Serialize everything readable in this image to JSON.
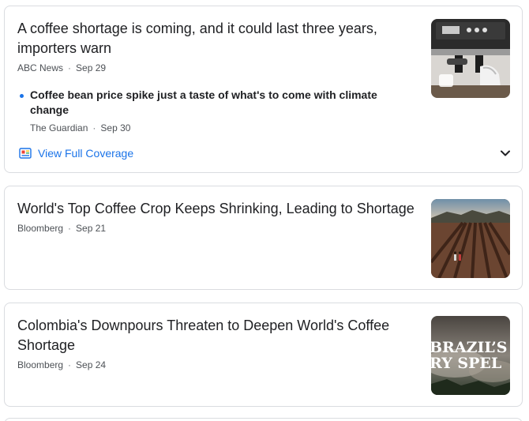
{
  "articles": [
    {
      "title": "A coffee shortage is coming, and it could last three years, importers warn",
      "source": "ABC News",
      "date": "Sep 29",
      "related": {
        "title": "Coffee bean price spike just a taste of what's to come with climate change",
        "source": "The Guardian",
        "date": "Sep 30"
      },
      "coverage_label": "View Full Coverage",
      "thumb_icon": "espresso-machine-photo"
    },
    {
      "title": "World's Top Coffee Crop Keeps Shrinking, Leading to Shortage",
      "source": "Bloomberg",
      "date": "Sep 21",
      "thumb_icon": "coffee-field-photo"
    },
    {
      "title": "Colombia's Downpours Threaten to Deepen World's Coffee Shortage",
      "source": "Bloomberg",
      "date": "Sep 24",
      "thumb_icon": "brazil-dry-spell-photo",
      "thumb_text": "BRAZIL'S DRY SPELL"
    }
  ],
  "colors": {
    "link": "#1a73e8",
    "title": "#202124",
    "meta": "#4d5156",
    "border": "#dadce0"
  }
}
